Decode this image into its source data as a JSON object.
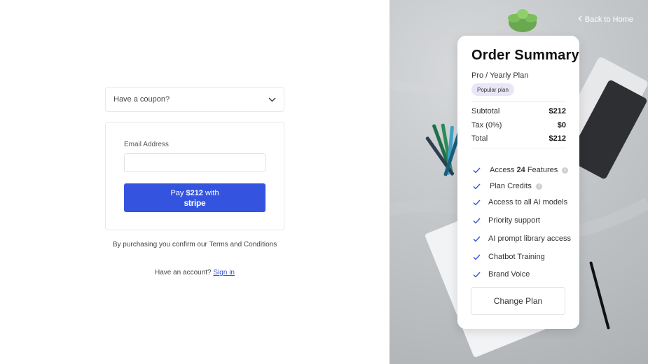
{
  "coupon": {
    "label": "Have a coupon?",
    "icon": "chevron-down-icon"
  },
  "form": {
    "email_label": "Email Address",
    "email_value": "",
    "pay_prefix": "Pay ",
    "pay_amount": "$212",
    "pay_suffix": " with",
    "pay_brand": "stripe",
    "button_color": "#3454e0"
  },
  "terms": {
    "text": "By purchasing you confirm our Terms and Conditions"
  },
  "account": {
    "prompt": "Have an account?",
    "signin": "Sign in"
  },
  "nav": {
    "back_label": "Back to Home",
    "icon": "chevron-left-icon"
  },
  "summary": {
    "title": "Order Summary",
    "plan": "Pro / Yearly Plan",
    "badge": "Popular plan",
    "rows": [
      {
        "label": "Subtotal",
        "value": "$212"
      },
      {
        "label": "Tax (0%)",
        "value": "$0"
      },
      {
        "label": "Total",
        "value": "$212"
      }
    ],
    "features": [
      {
        "pre": "Access ",
        "bold": "24",
        "post": " Features",
        "info": true
      },
      {
        "pre": "Plan Credits",
        "bold": "",
        "post": "",
        "info": true
      },
      {
        "pre": "Access to all AI models",
        "bold": "",
        "post": "",
        "info": false
      },
      {
        "pre": "Priority support",
        "bold": "",
        "post": "",
        "info": false
      },
      {
        "pre": "AI prompt library access",
        "bold": "",
        "post": "",
        "info": false
      },
      {
        "pre": "Chatbot Training",
        "bold": "",
        "post": "",
        "info": false
      },
      {
        "pre": "Brand Voice",
        "bold": "",
        "post": "",
        "info": false
      }
    ],
    "change_plan": "Change Plan",
    "check_color": "#3454e0"
  }
}
